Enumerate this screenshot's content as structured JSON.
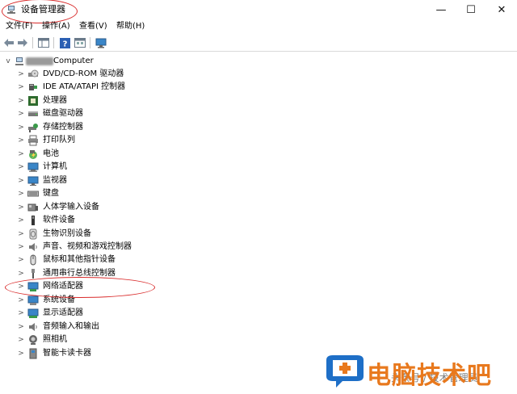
{
  "window": {
    "title": "设备管理器",
    "buttons": [
      "—",
      "☐",
      "✕"
    ]
  },
  "menu": [
    {
      "label": "文件(F)"
    },
    {
      "label": "操作(A)"
    },
    {
      "label": "查看(V)"
    },
    {
      "label": "帮助(H)"
    }
  ],
  "toolbar": {
    "icons": [
      "back-arrow-icon",
      "forward-arrow-icon",
      "properties-grid-icon",
      "help-icon",
      "view-grid-icon",
      "monitor-icon"
    ]
  },
  "tree": {
    "root": {
      "label": "Computer",
      "expand": "v"
    },
    "collapsed_glyph": ">",
    "items": [
      {
        "label": "DVD/CD-ROM 驱动器",
        "icon": "dvd-drive-icon"
      },
      {
        "label": "IDE ATA/ATAPI 控制器",
        "icon": "ide-controller-icon"
      },
      {
        "label": "处理器",
        "icon": "processor-icon"
      },
      {
        "label": "磁盘驱动器",
        "icon": "disk-drive-icon"
      },
      {
        "label": "存储控制器",
        "icon": "storage-controller-icon"
      },
      {
        "label": "打印队列",
        "icon": "printer-icon"
      },
      {
        "label": "电池",
        "icon": "battery-icon"
      },
      {
        "label": "计算机",
        "icon": "computer-icon"
      },
      {
        "label": "监视器",
        "icon": "monitor-icon"
      },
      {
        "label": "键盘",
        "icon": "keyboard-icon"
      },
      {
        "label": "人体学输入设备",
        "icon": "hid-icon"
      },
      {
        "label": "软件设备",
        "icon": "software-device-icon"
      },
      {
        "label": "生物识别设备",
        "icon": "biometric-icon"
      },
      {
        "label": "声音、视频和游戏控制器",
        "icon": "speaker-icon"
      },
      {
        "label": "鼠标和其他指针设备",
        "icon": "mouse-icon"
      },
      {
        "label": "通用串行总线控制器",
        "icon": "usb-icon"
      },
      {
        "label": "网络适配器",
        "icon": "network-adapter-icon"
      },
      {
        "label": "系统设备",
        "icon": "system-device-icon"
      },
      {
        "label": "显示适配器",
        "icon": "display-adapter-icon"
      },
      {
        "label": "音频输入和输出",
        "icon": "audio-io-icon"
      },
      {
        "label": "照相机",
        "icon": "camera-icon"
      },
      {
        "label": "智能卡读卡器",
        "icon": "smartcard-reader-icon"
      }
    ]
  },
  "watermark": {
    "brand": "电脑技术吧",
    "sub": "头条号 / 技术管理员",
    "accent": "#e8791e",
    "blue": "#1e6fc7"
  },
  "annotation_color": "#d92b2b"
}
